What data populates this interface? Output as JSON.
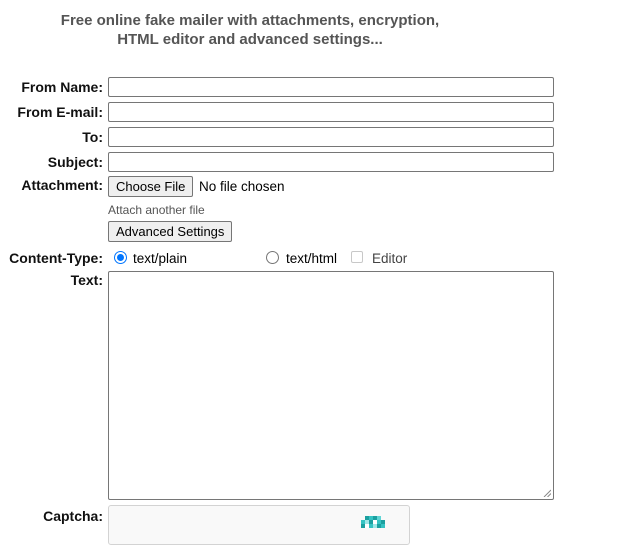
{
  "header": {
    "line1": "Free online fake mailer with attachments, encryption,",
    "line2": "HTML editor and advanced settings..."
  },
  "form": {
    "from_name_label": "From Name:",
    "from_email_label": "From E-mail:",
    "to_label": "To:",
    "subject_label": "Subject:",
    "attachment_label": "Attachment:",
    "choose_file_label": "Choose File",
    "no_file_text": "No file chosen",
    "attach_another_text": "Attach another file",
    "advanced_settings_label": "Advanced Settings",
    "content_type_label": "Content-Type:",
    "radio_plain_label": "text/plain",
    "radio_html_label": "text/html",
    "editor_label": "Editor",
    "text_label": "Text:",
    "captcha_label": "Captcha:",
    "from_name_value": "",
    "from_email_value": "",
    "to_value": "",
    "subject_value": "",
    "text_value": "",
    "content_type_selected": "text/plain",
    "editor_checked": false
  },
  "icons": {
    "captcha_logo": "recaptcha-icon",
    "resize_grip": "resize-grip-icon"
  },
  "colors": {
    "radio_accent": "#0075ff",
    "header_text": "#555555",
    "button_bg": "#efefef"
  }
}
